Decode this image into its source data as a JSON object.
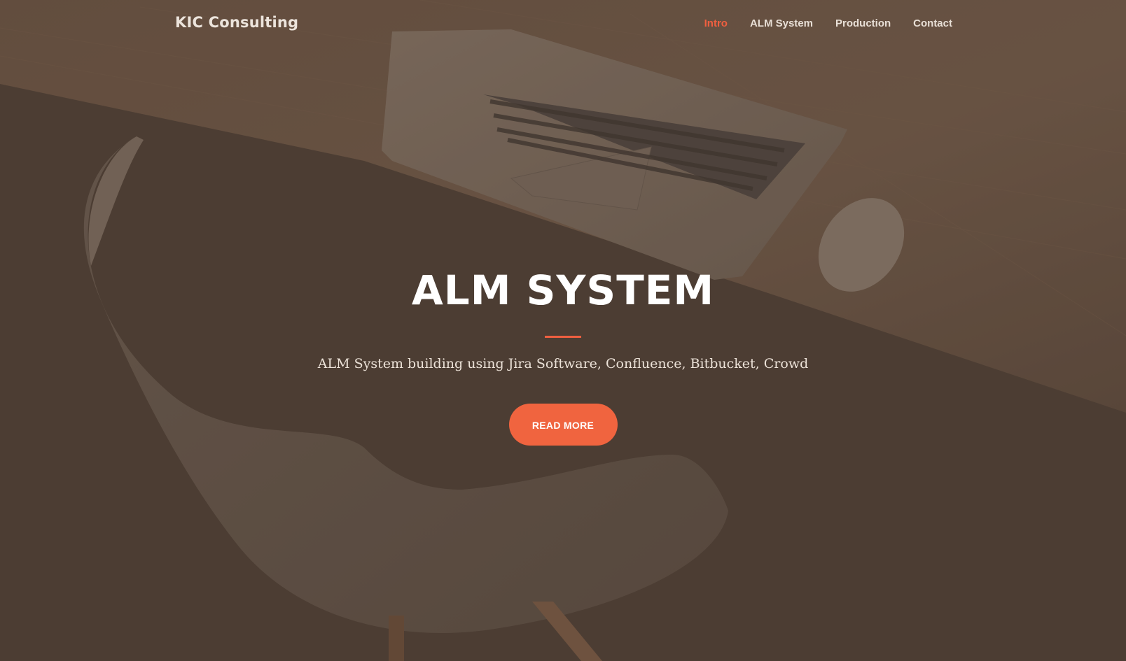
{
  "nav": {
    "brand": "KIC Consulting",
    "items": [
      {
        "label": "Intro",
        "active": true
      },
      {
        "label": "ALM System",
        "active": false
      },
      {
        "label": "Production",
        "active": false
      },
      {
        "label": "Contact",
        "active": false
      }
    ]
  },
  "hero": {
    "title": "ALM SYSTEM",
    "subtitle": "ALM System building using Jira Software, Confluence, Bitbucket, Crowd",
    "button_label": "READ MORE"
  },
  "colors": {
    "accent": "#f05f40",
    "overlay": "#4c3e34",
    "text": "#ffffff"
  },
  "background": {
    "description_icons": [
      "laptop-image",
      "mouse-image",
      "chair-image",
      "desk-image"
    ]
  }
}
